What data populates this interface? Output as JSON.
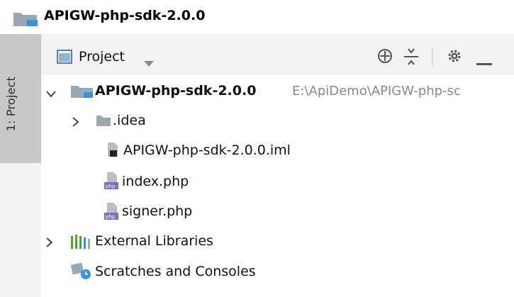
{
  "titlebar": {
    "project_name": "APIGW-php-sdk-2.0.0"
  },
  "tool_window_strip": {
    "project_tab_label": "1: Project"
  },
  "project_panel": {
    "view_selector": "Project",
    "tools": [
      "locate-icon",
      "collapse-all-icon",
      "gear-icon",
      "hide-icon"
    ]
  },
  "tree": {
    "root": {
      "name": "APIGW-php-sdk-2.0.0",
      "path": "E:\\ApiDemo\\APIGW-php-sc"
    },
    "items": [
      {
        "name": ".idea",
        "icon": "folder-icon"
      },
      {
        "name": "APIGW-php-sdk-2.0.0.iml",
        "icon": "iml-file-icon"
      },
      {
        "name": "index.php",
        "icon": "php-file-icon"
      },
      {
        "name": "signer.php",
        "icon": "php-file-icon"
      }
    ],
    "external_libraries": "External Libraries",
    "scratches": "Scratches and Consoles"
  },
  "colors": {
    "folder_gray": "#9aa7b0",
    "folder_blue": "#3d8fd6",
    "php_purple": "#7b6fc6",
    "strip_active": "#c8c8c8",
    "header_bg": "#f2f2f2"
  }
}
